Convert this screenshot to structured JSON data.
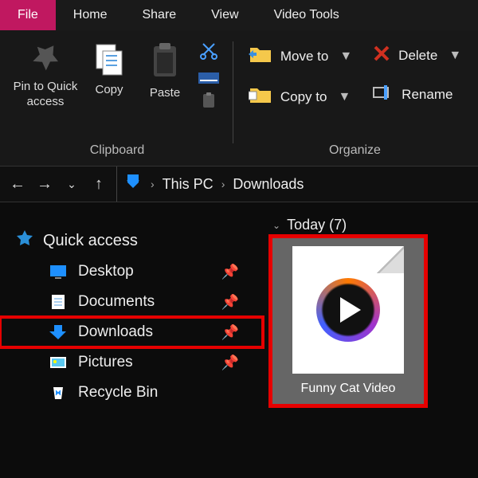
{
  "tabs": {
    "file": "File",
    "home": "Home",
    "share": "Share",
    "view": "View",
    "video": "Video Tools"
  },
  "ribbon": {
    "pin": "Pin to Quick access",
    "copy": "Copy",
    "paste": "Paste",
    "clipboard_group": "Clipboard",
    "moveto": "Move to",
    "copyto": "Copy to",
    "delete": "Delete",
    "rename": "Rename",
    "organize_group": "Organize"
  },
  "breadcrumb": {
    "root": "This PC",
    "current": "Downloads"
  },
  "sidebar": {
    "header": "Quick access",
    "items": [
      {
        "label": "Desktop"
      },
      {
        "label": "Documents"
      },
      {
        "label": "Downloads"
      },
      {
        "label": "Pictures"
      },
      {
        "label": "Recycle Bin"
      }
    ]
  },
  "content": {
    "group": "Today (7)",
    "file": "Funny Cat Video"
  }
}
